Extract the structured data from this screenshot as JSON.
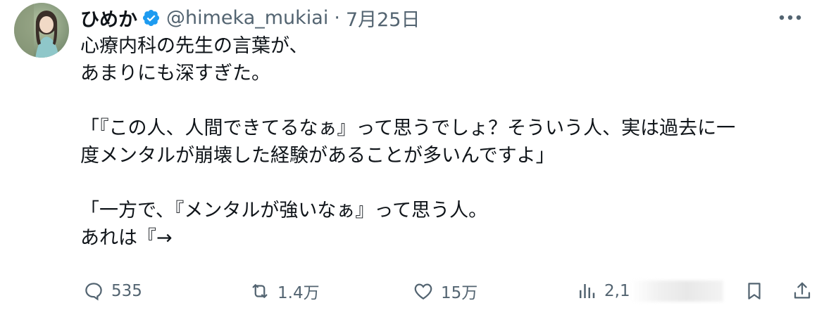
{
  "author": {
    "display_name": "ひめか",
    "handle": "@himeka_mukiai",
    "separator": "·",
    "date": "7月25日",
    "verified_icon": "verified-badge-icon",
    "verified_color": "#1d9bf0"
  },
  "tweet": {
    "lines": [
      "心療内科の先生の言葉が、",
      "あまりにも深すぎた。",
      "",
      "「『この人、人間できてるなぁ』って思うでしょ？そういう人、実は過去に一",
      "度メンタルが崩壊した経験があることが多いんですよ」",
      "",
      "「一方で、『メンタルが強いなぁ』って思う人。",
      "あれは『→"
    ]
  },
  "actions": {
    "reply_count": "535",
    "repost_count": "1.4万",
    "like_count": "15万",
    "views_count": "2,1",
    "icons": [
      "reply-icon",
      "repost-icon",
      "like-icon",
      "views-icon",
      "bookmark-icon",
      "share-icon"
    ]
  },
  "colors": {
    "text": "#0f1419",
    "secondary": "#536471",
    "accent": "#1d9bf0"
  }
}
